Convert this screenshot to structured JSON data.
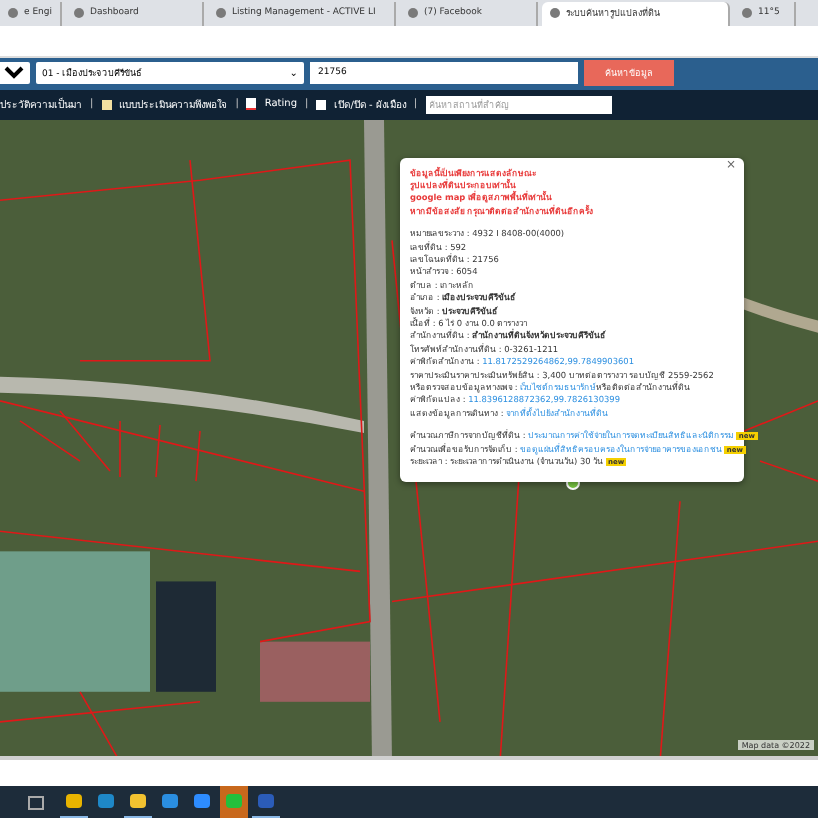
{
  "browser_tabs": [
    {
      "title": "e Engi",
      "selected": false
    },
    {
      "title": "Dashboard",
      "selected": false
    },
    {
      "title": "Listing Management - ACTIVE LI",
      "selected": false
    },
    {
      "title": "(7) Facebook",
      "selected": false
    },
    {
      "title": "ระบบค้นหารูปแปลงที่ดิน",
      "selected": true
    },
    {
      "title": "11°5",
      "selected": false
    }
  ],
  "search_bar": {
    "district": "01 - เมืองประจวบคีรีขันธ์",
    "caret": "⌄",
    "deed_number": "21756",
    "button": "ค้นหาข้อมูล"
  },
  "nav": {
    "separator": "|",
    "city_plan_checked": false,
    "items": [
      "ประวัติความเป็นมา",
      "แบบประเมินความพึงพอใจ",
      "Rating",
      "เปิด/ปิด - ผังเมือง"
    ],
    "search_placeholder": "ค้นหาสถานที่สำคัญ"
  },
  "popup": {
    "colon": ":",
    "notice": [
      "ข้อมูลนี้เป็นเพียงการแสดงลักษณะ",
      "รูปแปลงที่ดินประกอบเท่านั้น",
      "google map เพื่อดูสภาพพื้นที่เท่านั้น",
      "หากมีข้อสงสัย กรุณาติดต่อสำนักงานที่ดินอีกครั้ง"
    ],
    "fields": [
      {
        "label": "หมายเลขระวาง",
        "value": "4932 I 8408-00(4000)",
        "kind": "plain"
      },
      {
        "label": "เลขที่ดิน",
        "value": "592",
        "kind": "plain"
      },
      {
        "label": "เลขโฉนดที่ดิน",
        "value": "21756",
        "kind": "plain"
      },
      {
        "label": "หน้าสำรวจ",
        "value": "6054",
        "kind": "plain"
      },
      {
        "label": "ตำบล",
        "value": "เกาะหลัก",
        "kind": "plain"
      },
      {
        "label": "อำเภอ",
        "value": "เมืองประจวบคีรีขันธ์",
        "kind": "bold"
      },
      {
        "label": "จังหวัด",
        "value": "ประจวบคีรีขันธ์",
        "kind": "bold"
      },
      {
        "label": "เนื้อที่",
        "value": "6 ไร่ 0 งาน 0.0 ตารางวา",
        "kind": "plain"
      },
      {
        "label": "สำนักงานที่ดิน",
        "value": "สำนักงานที่ดินจังหวัดประจวบคีรีขันธ์",
        "kind": "bold"
      },
      {
        "label": "โทรศัพท์สำนักงานที่ดิน",
        "value": "0-3261-1211",
        "kind": "plain"
      },
      {
        "label": "ค่าพิกัดสำนักงาน",
        "value": "11.8172529264862,99.7849903601",
        "kind": "link"
      },
      {
        "label": "ราคาประเมินราคาประเมินทรัพย์สิน",
        "value": "3,400 บาทต่อตารางวา รอบบัญชี 2559-2562",
        "kind": "plain"
      },
      {
        "label": "หรือตรวจสอบข้อมูลทางเพจ",
        "value": "เว็บไซต์กรมธนารักษ์",
        "suffix": "หรือติดต่อสำนักงานที่ดิน",
        "kind": "link"
      },
      {
        "label": "ค่าพิกัดแปลง",
        "value": "11.8396128872362,99.7826130399",
        "kind": "link"
      },
      {
        "label": "แสดงข้อมูลการเดินทาง",
        "value": "จากที่ตั้งไปยังสำนักงานที่ดิน",
        "kind": "link"
      }
    ],
    "extras": [
      {
        "label": "คำนวณภาษีการจากบัญชีที่ดิน",
        "value": "ประมาณการค่าใช้จ่ายในการจดทะเบียนสิทธิและนิติกรรม",
        "kind": "link",
        "badge": "new"
      },
      {
        "label": "คำนวณเพื่อขอรับการจัดเก็บ",
        "value": "ขอดูแผ่นที่สิทธิครอบครองในการจ่ายอาคารของเอกชน",
        "kind": "link",
        "badge": "new"
      },
      {
        "label": "ระยะเวลา",
        "value": "ระยะเวลาการดำเนินงาน (จำนวนวัน) 30 วัน",
        "kind": "plain",
        "badge": "new"
      }
    ],
    "close": "×"
  },
  "map_footer": "Map data ©2022",
  "taskbar": [
    {
      "color": "#e8b400",
      "running": true,
      "highlighted": false
    },
    {
      "color": "#1e88c8",
      "running": false,
      "highlighted": false
    },
    {
      "color": "#f2c230",
      "running": true,
      "highlighted": false
    },
    {
      "color": "#2a8ee0",
      "running": false,
      "highlighted": false
    },
    {
      "color": "#2d8cff",
      "running": false,
      "highlighted": false
    },
    {
      "color": "#22c03c",
      "running": false,
      "highlighted": true
    },
    {
      "color": "#2b5cb8",
      "running": true,
      "highlighted": false
    }
  ]
}
